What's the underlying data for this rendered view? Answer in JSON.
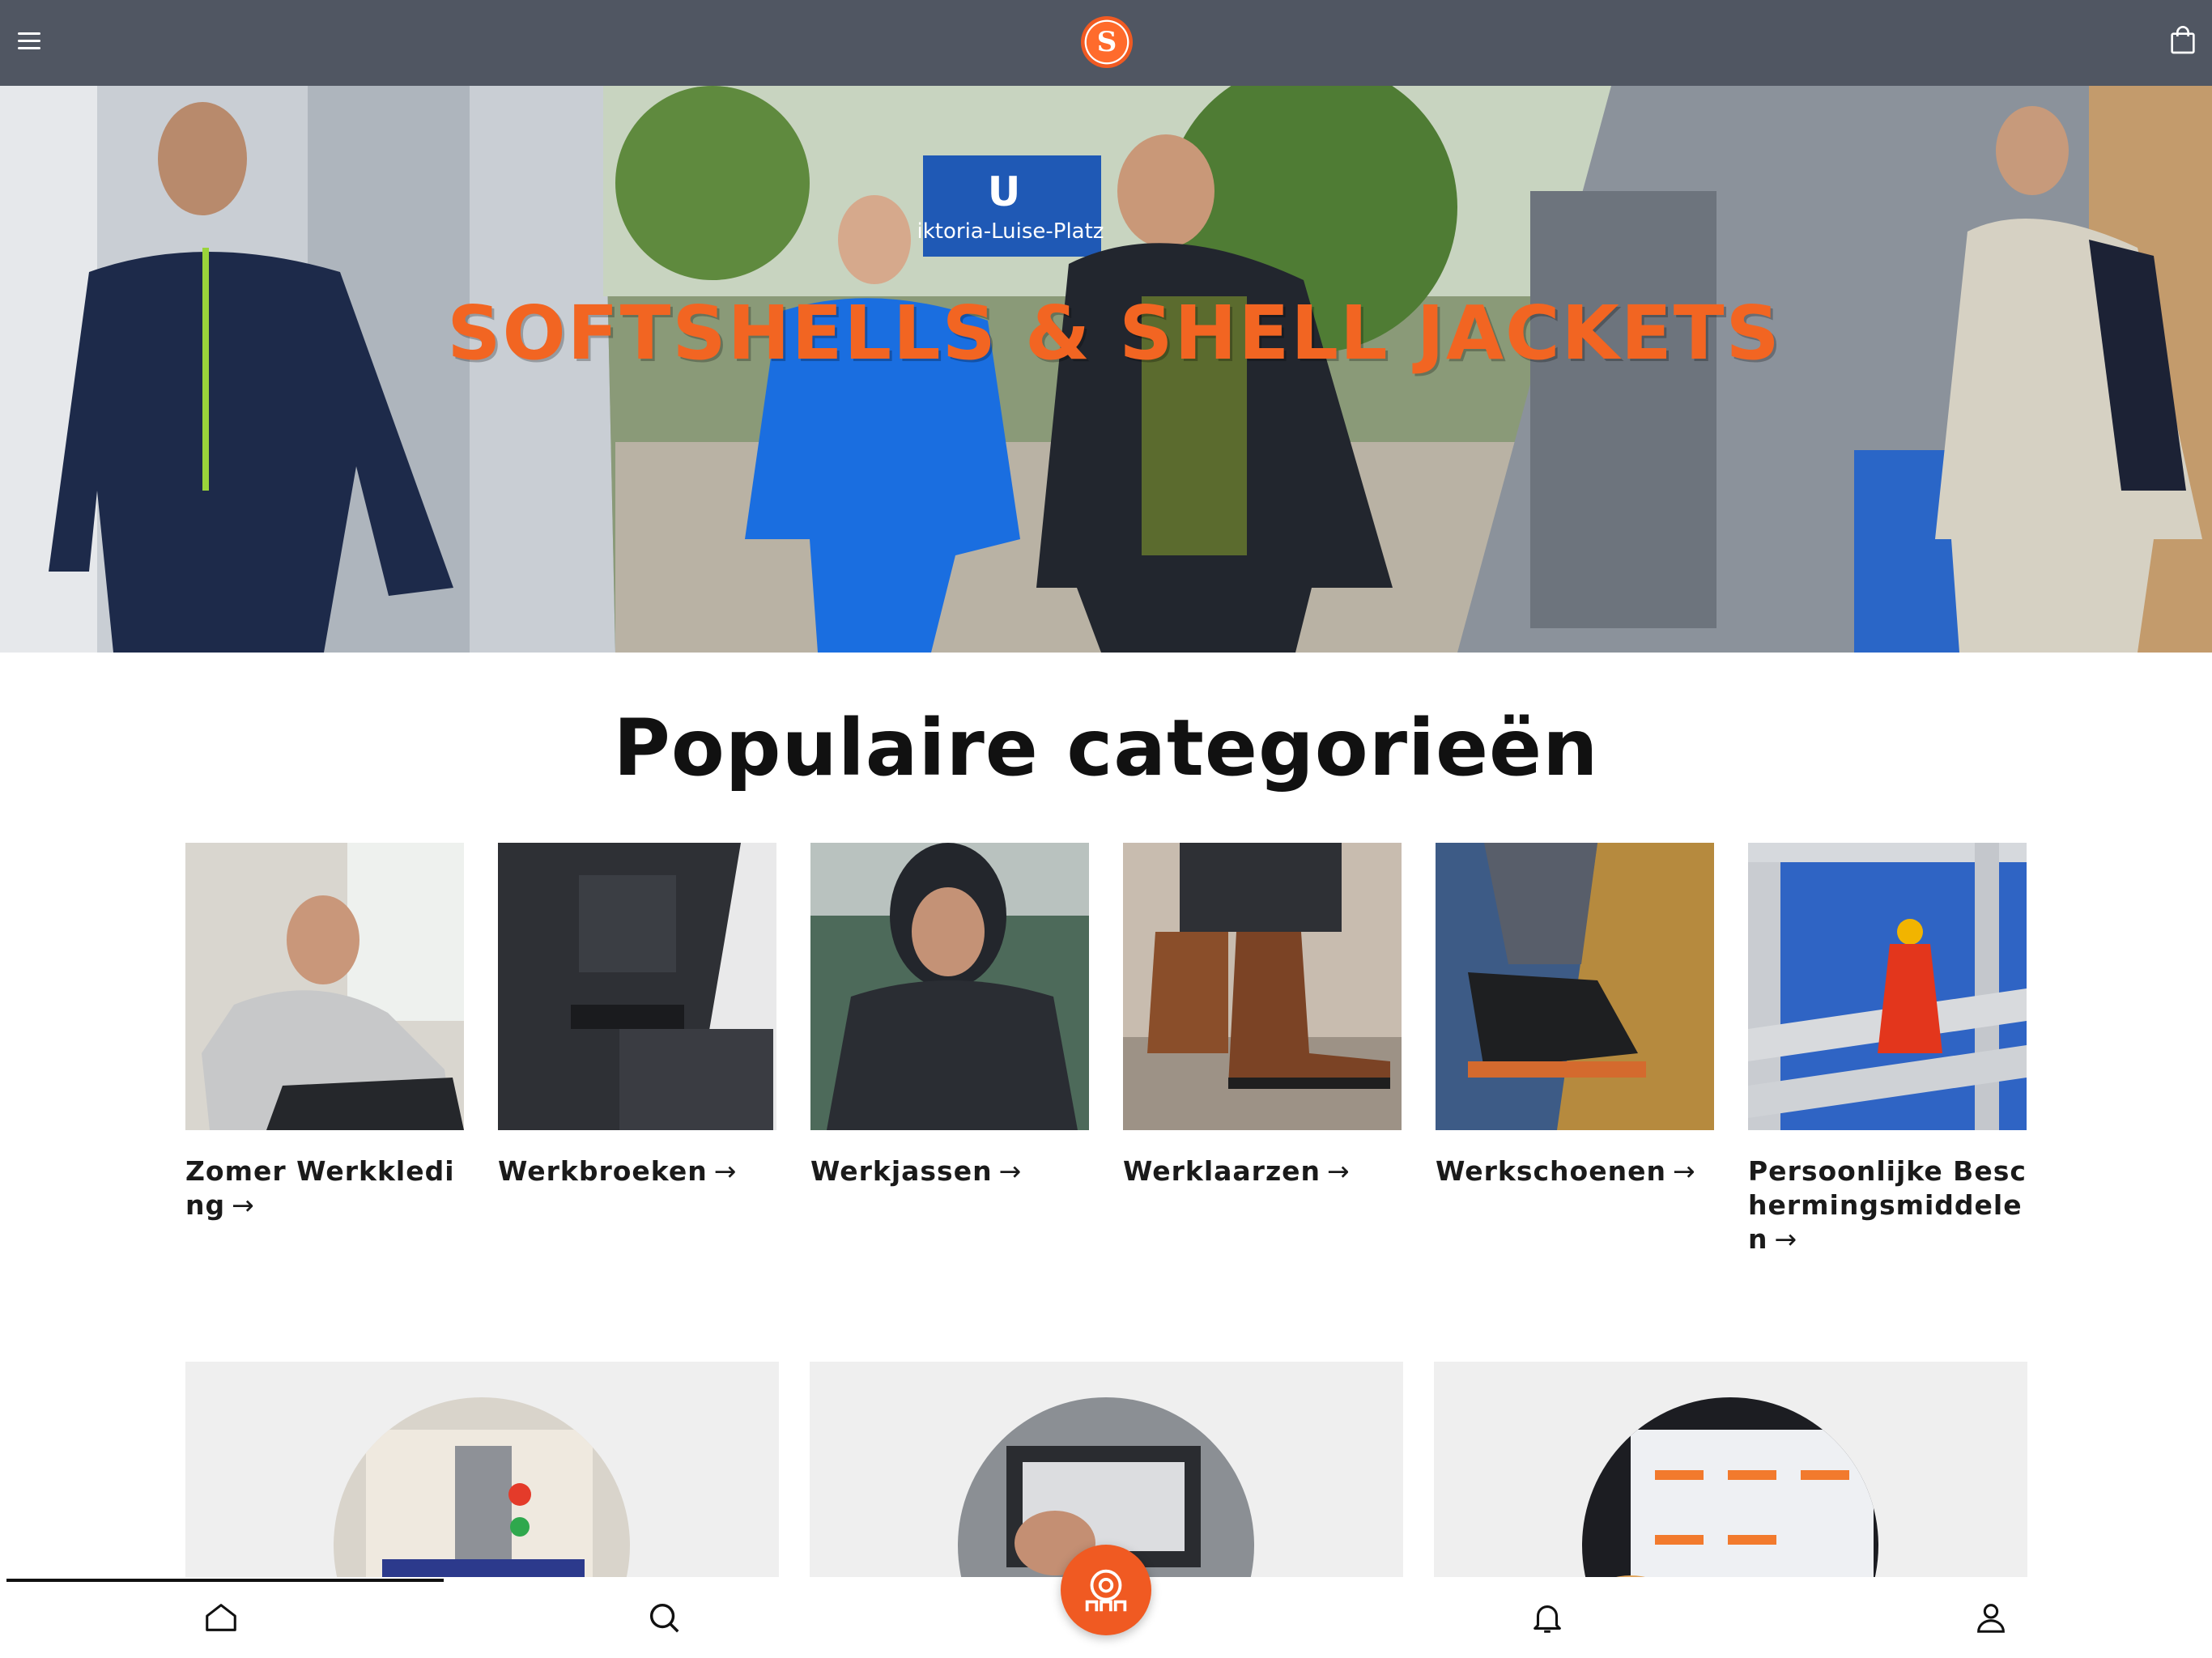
{
  "header": {
    "menu_icon": "hamburger-menu-icon",
    "logo_letter": "S",
    "cart_icon": "shopping-bag-icon",
    "bar_color": "#505662"
  },
  "hero": {
    "title": "SOFTSHELLS & SHELL JACKETS",
    "sign_letter": "U",
    "sign_text": "iktoria-Luise-Platz",
    "title_color": "#f26522"
  },
  "categories": {
    "title": "Populaire categorieën",
    "items": [
      {
        "label": "Zomer Werkkleding",
        "arrow": "→"
      },
      {
        "label": "Werkbroeken",
        "arrow": "→"
      },
      {
        "label": "Werkjassen",
        "arrow": "→"
      },
      {
        "label": "Werklaarzen",
        "arrow": "→"
      },
      {
        "label": "Werkschoenen",
        "arrow": "→"
      },
      {
        "label": "Persoonlijke Beschermingsmiddelen",
        "arrow": "→"
      }
    ]
  },
  "features": [
    {
      "name": "embroidery-machine"
    },
    {
      "name": "printing-press"
    },
    {
      "name": "webshop-screen"
    }
  ],
  "bottom_nav": {
    "items": [
      "home-icon",
      "search-icon",
      "service-icon",
      "bell-icon",
      "user-icon"
    ],
    "accent": "#f05a22"
  }
}
